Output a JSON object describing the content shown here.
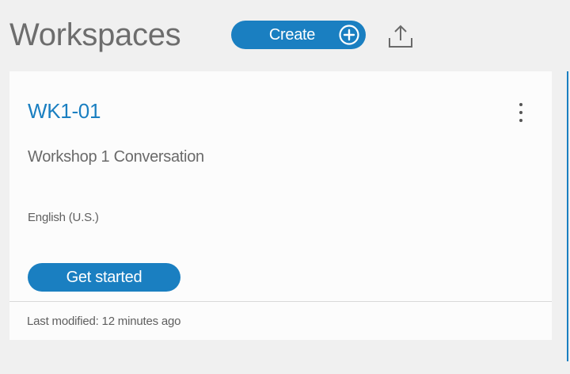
{
  "header": {
    "title": "Workspaces",
    "create_label": "Create",
    "create_icon": "plus-circle-icon",
    "upload_icon": "upload-icon"
  },
  "workspace_card": {
    "name": "WK1-01",
    "description": "Workshop 1 Conversation",
    "language": "English (U.S.)",
    "action_label": "Get started",
    "menu_icon": "overflow-menu-icon",
    "last_modified": "Last modified: 12 minutes ago"
  },
  "colors": {
    "accent": "#1a7fc1",
    "background": "#f0f0f0",
    "card": "#fcfcfc"
  }
}
